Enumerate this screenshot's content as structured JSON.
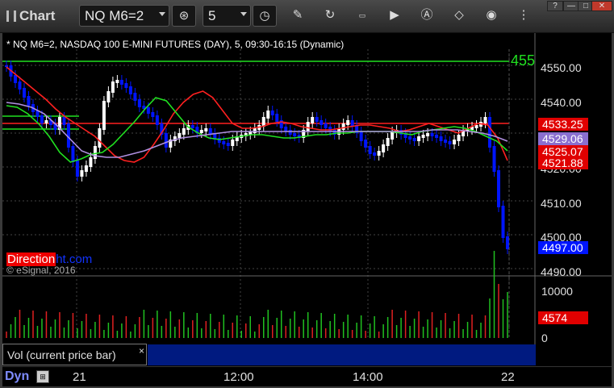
{
  "toolbar": {
    "title": "Chart",
    "symbol": "NQ M6=2",
    "interval": "5",
    "icons": [
      "crosshair-cursor-icon",
      "pencil-icon",
      "refresh-icon",
      "ticker-tag-icon",
      "play-icon",
      "text-a-icon",
      "eraser-icon",
      "camera-icon",
      "more-icon"
    ]
  },
  "window_buttons": {
    "help": "?",
    "minimize": "—",
    "maximize": "□",
    "close": "✕"
  },
  "chart": {
    "header": "* NQ M6=2, NASDAQ 100 E-MINI FUTURES (DAY), 5, 09:30-16:15 (Dynamic)",
    "price_axis_ticks": [
      "4550.00",
      "4540.00",
      "4520.00",
      "4510.00",
      "4500.00",
      "4490.00"
    ],
    "price_badges": [
      {
        "label": "4533.25",
        "color": "#e00000"
      },
      {
        "label": "4529.06",
        "color": "#8a6fd0"
      },
      {
        "label": "4525.07",
        "color": "#e00000"
      },
      {
        "label": "4521.88",
        "color": "#e00000"
      },
      {
        "label": "4497.00",
        "color": "#0015ff"
      }
    ],
    "level_label": "455",
    "brand": {
      "red": "Direction",
      "blue": "ht.com"
    },
    "copyright": "© eSignal, 2016",
    "volume_axis_ticks": [
      "10000",
      "0"
    ],
    "volume_badge": {
      "label": "4574",
      "color": "#e00000"
    },
    "volume_legend": "Vol (current price bar)",
    "volume_legend_close": "×",
    "time_axis": {
      "mode": "Dyn",
      "labels": [
        "21",
        "12:00",
        "14:00",
        "22"
      ]
    },
    "colors": {
      "up": "#ffffff",
      "down": "#0015ff",
      "ma_fast": "#ff2020",
      "ma_mid": "#20e020",
      "ma_slow": "#b090e0",
      "vol_up": "#20c020",
      "vol_down": "#e02020"
    }
  }
}
